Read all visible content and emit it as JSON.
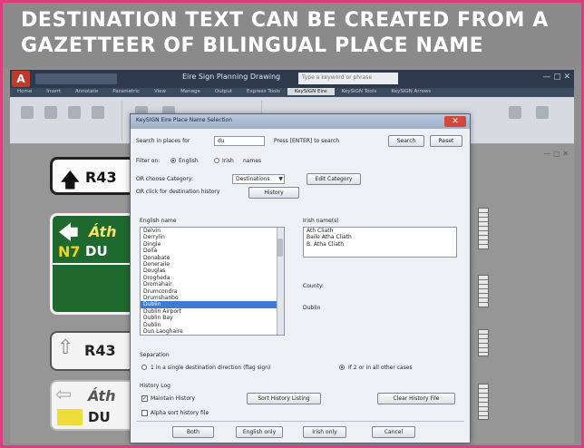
{
  "headline": {
    "line1": "DESTINATION TEXT CAN BE CREATED FROM A",
    "line2": "GAZETTEER OF BILINGUAL PLACE NAME"
  },
  "cad": {
    "doc_title": "Eire Sign Planning Drawing",
    "search_placeholder": "Type a keyword or phrase",
    "ribbon_tabs": [
      "Home",
      "Insert",
      "Annotate",
      "Parametric",
      "View",
      "Manage",
      "Output",
      "Express Tools",
      "KeySIGN Eire",
      "KeySIGN Tools",
      "KeySIGN Arrows"
    ],
    "active_tab_index": 8,
    "app_letter": "A"
  },
  "signs": {
    "sign1": {
      "arrow": "🡅",
      "route": "R43"
    },
    "sign2": {
      "arrow": "🡄",
      "irish": "Áth",
      "route_no": "N7",
      "english": "DU"
    },
    "sign3": {
      "arrow": "⇧",
      "route": "R43"
    },
    "sign4": {
      "arrow": "⇦",
      "irish": "Áth",
      "english": "DU"
    }
  },
  "dialog": {
    "title": "KeySIGN Eire Place Name Selection",
    "close_label": "✕",
    "search_label": "Search in places for",
    "search_value": "du",
    "search_hint": "Press [ENTER] to search",
    "search_button": "Search",
    "reset_button": "Reset",
    "filter_label": "Filter on:",
    "filter_options": [
      "English",
      "Irish",
      "names"
    ],
    "filter_selected": 0,
    "category_label": "OR choose Category:",
    "category_value": "Destinations",
    "edit_category_button": "Edit Category",
    "history_label": "OR click for destination history",
    "history_button": "History",
    "english_names_label": "English name",
    "english_names": [
      "Delvin",
      "Derrylin",
      "Dingle",
      "Dolla",
      "Donabate",
      "Doneraile",
      "Douglas",
      "Drogheda",
      "Dromahair",
      "Drumcondra",
      "Drumshanbo",
      "Dublin",
      "Dublin Airport",
      "Dublin Bay",
      "Dublin",
      "Dun Laoghaire"
    ],
    "selected_english_index": 11,
    "irish_names_label": "Irish name(s)",
    "irish_names": [
      "Áth Cliath",
      "Baile Átha Cliath",
      "B. Átha Cliath"
    ],
    "county_label": "County:",
    "county_value": "Dublin",
    "separation_label": "Separation",
    "sep_option1": "1 in a single destination direction (flag sign)",
    "sep_option2": "If 2 or in all other cases",
    "history_log_label": "History Log",
    "maintain_history_label": "Maintain History",
    "maintain_history_checked": true,
    "alpha_history_label": "Alpha sort history file",
    "alpha_history_checked": false,
    "sort_history_button": "Sort History Listing",
    "clear_history_button": "Clear History File",
    "bottom_buttons": [
      "Both",
      "English only",
      "Irish only",
      "Cancel"
    ]
  }
}
